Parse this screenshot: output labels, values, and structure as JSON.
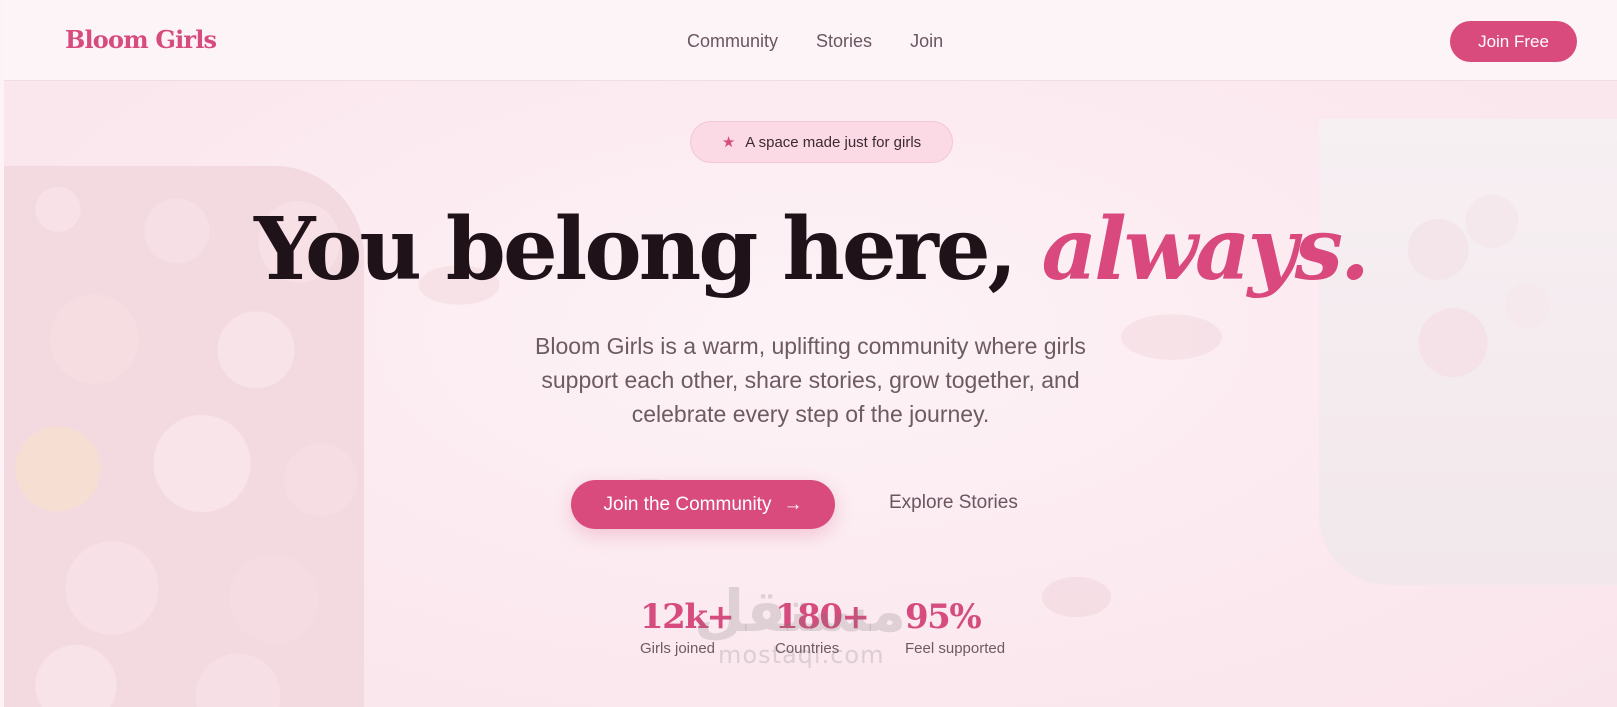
{
  "header": {
    "brand": "Bloom Girls",
    "nav": [
      "Community",
      "Stories",
      "Join"
    ],
    "cta": "Join Free"
  },
  "hero": {
    "badge_icon": "star-icon",
    "badge": "A space made just for girls",
    "headline_main": "You belong here,",
    "headline_accent": "always.",
    "subtitle": "Bloom Girls is a warm, uplifting community where girls support each other, share stories, grow together, and celebrate every step of the journey.",
    "primary_cta": "Join the Community",
    "primary_cta_icon": "arrow-right-icon",
    "secondary_cta": "Explore Stories",
    "stats": [
      {
        "value": "12k+",
        "label": "Girls joined"
      },
      {
        "value": "180+",
        "label": "Countries"
      },
      {
        "value": "95%",
        "label": "Feel supported"
      }
    ]
  },
  "watermark": {
    "arabic": "مستقل",
    "latin": "mostaql.com"
  },
  "colors": {
    "accent": "#d94b7c",
    "text": "#1f1219",
    "muted": "#6d5a63",
    "background": "#fdf0f4"
  }
}
